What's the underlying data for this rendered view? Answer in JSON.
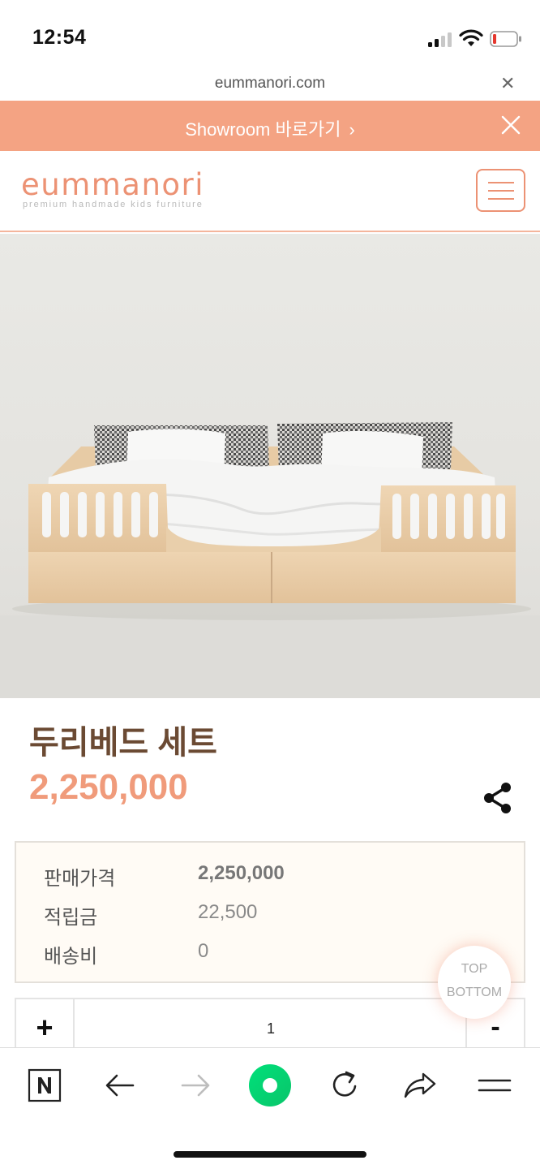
{
  "status_bar": {
    "time": "12:54"
  },
  "browser": {
    "url": "eummanori.com",
    "close_icon": "close-icon"
  },
  "banner": {
    "text": "Showroom 바로가기",
    "chevron": "›",
    "close_icon": "close-icon",
    "color": "#f4a383"
  },
  "header": {
    "logo_word": "eummanori",
    "logo_tagline": "premium handmade kids furniture",
    "menu_icon": "hamburger-menu-icon",
    "accent": "#ec9274"
  },
  "product": {
    "name": "두리베드 세트",
    "price": "2,250,000",
    "share_icon": "share-icon",
    "price_color": "#f09b7b",
    "name_color": "#6b4a33"
  },
  "price_table": {
    "rows": [
      {
        "label": "판매가격",
        "value": "2,250,000"
      },
      {
        "label": "적립금",
        "value": "22,500"
      },
      {
        "label": "배송비",
        "value": "0"
      }
    ]
  },
  "quantity": {
    "plus_label": "+",
    "value": "1",
    "minus_label": "-"
  },
  "float_nav": {
    "top_label": "TOP",
    "bottom_label": "BOTTOM"
  },
  "toolbar": {
    "items": [
      "naver-n-icon",
      "back-arrow-icon",
      "forward-arrow-icon",
      "green-dot-icon",
      "reload-icon",
      "share-arrow-icon",
      "menu-lines-icon"
    ]
  }
}
